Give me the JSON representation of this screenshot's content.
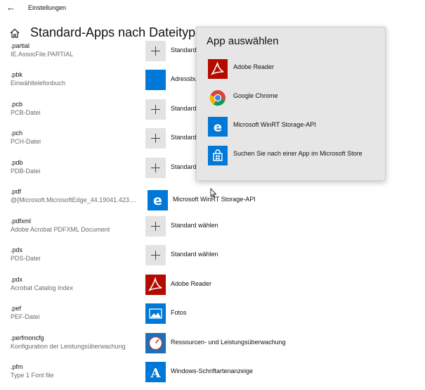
{
  "window": {
    "back_glyph": "←",
    "title": "Einstellungen"
  },
  "page": {
    "heading": "Standard-Apps nach Dateityp",
    "home_icon": "home-icon"
  },
  "rows": [
    {
      "ext": ".partial",
      "desc": "IE.AssocFile.PARTIAL",
      "app": "Standard wählen",
      "icon": "plus-icon"
    },
    {
      "ext": ".pbk",
      "desc": "Einwähltelefonbuch",
      "app": "Adressbuch",
      "icon": "blue-tile-icon"
    },
    {
      "ext": ".pcb",
      "desc": "PCB-Datei",
      "app": "Standard wählen",
      "icon": "plus-icon"
    },
    {
      "ext": ".pch",
      "desc": "PCH-Datei",
      "app": "Standard wählen",
      "icon": "plus-icon"
    },
    {
      "ext": ".pdb",
      "desc": "PDB-Datei",
      "app": "Standard wählen",
      "icon": "plus-icon"
    },
    {
      "ext": ".pdf",
      "desc": "@{Microsoft.MicrosoftEdge_44.19041.423....",
      "app": "Microsoft WinRT Storage-API",
      "icon": "edge-icon"
    },
    {
      "ext": ".pdfxml",
      "desc": "Adobe Acrobat PDFXML Document",
      "app": "Standard wählen",
      "icon": "plus-icon"
    },
    {
      "ext": ".pds",
      "desc": "PDS-Datei",
      "app": "Standard wählen",
      "icon": "plus-icon"
    },
    {
      "ext": ".pdx",
      "desc": "Acrobat Catalog Index",
      "app": "Adobe Reader",
      "icon": "adobe-reader-icon"
    },
    {
      "ext": ".pef",
      "desc": "PEF-Datei",
      "app": "Fotos",
      "icon": "photos-icon"
    },
    {
      "ext": ".perfmoncfg",
      "desc": "Konfiguration der Leistungsüberwachung",
      "app": "Ressourcen- und Leistungsüberwachung",
      "icon": "perfmon-icon"
    },
    {
      "ext": ".pfm",
      "desc": "Type 1 Font file",
      "app": "Windows-Schriftartenanzeige",
      "icon": "font-viewer-icon"
    }
  ],
  "popup": {
    "title": "App auswählen",
    "items": [
      {
        "label": "Adobe Reader",
        "icon": "adobe-reader-icon"
      },
      {
        "label": "Google Chrome",
        "icon": "chrome-icon"
      },
      {
        "label": "Microsoft WinRT Storage-API",
        "icon": "edge-icon"
      },
      {
        "label": "Suchen Sie nach einer App im Microsoft Store",
        "icon": "store-icon"
      }
    ]
  },
  "colors": {
    "accent": "#0078d7",
    "adobe_red": "#b30b00",
    "button_gray": "#e3e3e3",
    "popup_bg": "#e6e6e6"
  }
}
